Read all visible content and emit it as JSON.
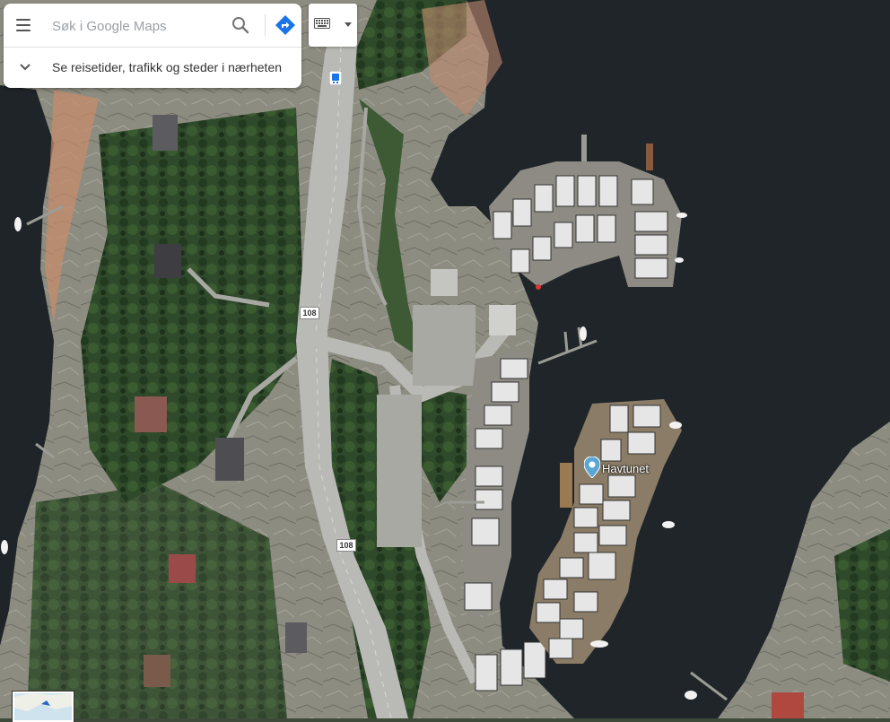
{
  "search": {
    "placeholder": "Søk i Google Maps",
    "explore_label": "Se reisetider, trafikk og steder i nærheten"
  },
  "map": {
    "type": "satellite",
    "route_shields": [
      "108",
      "108"
    ],
    "places": [
      {
        "name": "Havtunet",
        "icon": "map-pin-icon"
      }
    ],
    "transit_icon": "bus-stop-icon",
    "colors": {
      "water": "#1e2428",
      "rock": "#8a8a7c",
      "vegetation": "#2f4a2a",
      "road": "#b8b8b4",
      "pin": "#5aa7d6",
      "directions": "#1a73e8"
    }
  },
  "icons": {
    "menu": "menu-icon",
    "search": "search-icon",
    "directions": "directions-icon",
    "keyboard": "keyboard-icon",
    "chevron": "chevron-down-icon"
  }
}
